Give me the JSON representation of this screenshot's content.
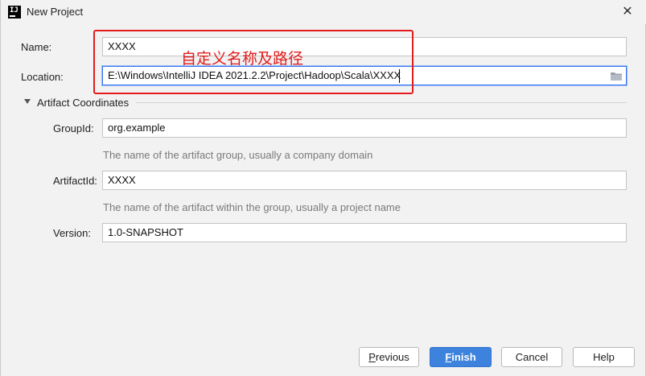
{
  "window": {
    "title": "New Project"
  },
  "form": {
    "name_label": "Name:",
    "name_value": "XXXX",
    "location_label": "Location:",
    "location_value": "E:\\Windows\\IntelliJ IDEA 2021.2.2\\Project\\Hadoop\\Scala\\XXXX",
    "artifact_section": "Artifact Coordinates",
    "groupid_label": "GroupId:",
    "groupid_value": "org.example",
    "groupid_hint": "The name of the artifact group, usually a company domain",
    "artifactid_label": "ArtifactId:",
    "artifactid_value": "XXXX",
    "artifactid_hint": "The name of the artifact within the group, usually a project name",
    "version_label": "Version:",
    "version_value": "1.0-SNAPSHOT"
  },
  "annotation": {
    "text": "自定义名称及路径",
    "color": "#e31b1b"
  },
  "buttons": {
    "previous_first": "P",
    "previous_rest": "revious",
    "finish_first": "F",
    "finish_rest": "inish",
    "cancel": "Cancel",
    "help": "Help"
  },
  "colors": {
    "accent": "#3d82dc",
    "focus": "#3574f0",
    "background": "#f2f2f2"
  }
}
